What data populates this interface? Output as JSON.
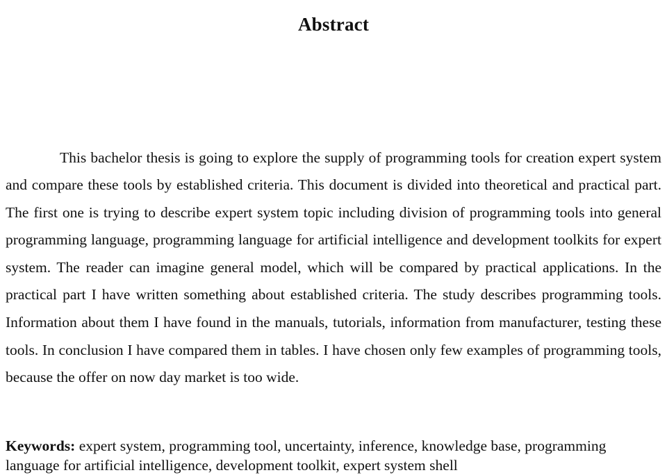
{
  "document": {
    "heading": "Abstract",
    "body_paragraph": "This bachelor thesis is going to explore the supply of programming tools for creation expert system and compare these tools by established criteria. This document is divided into theoretical and practical part. The first one is trying to describe expert system topic including division of programming tools into general programming language, programming language for artificial intelligence and development toolkits for expert system. The reader can imagine general model, which will be compared by practical applications. In the practical part I have written something about established criteria. The study describes programming tools. Information about them I have found in the manuals, tutorials, information from manufacturer, testing these tools. In conclusion I have compared them in tables. I have chosen only few examples of programming tools, because the offer on now day market is too wide.",
    "keywords": {
      "label": "Keywords:",
      "list": "expert system, programming tool, uncertainty, inference, knowledge base, programming language for artificial intelligence, development toolkit, expert system shell"
    },
    "colors": {
      "page_background": "#ffffff",
      "text": "#111111"
    }
  }
}
